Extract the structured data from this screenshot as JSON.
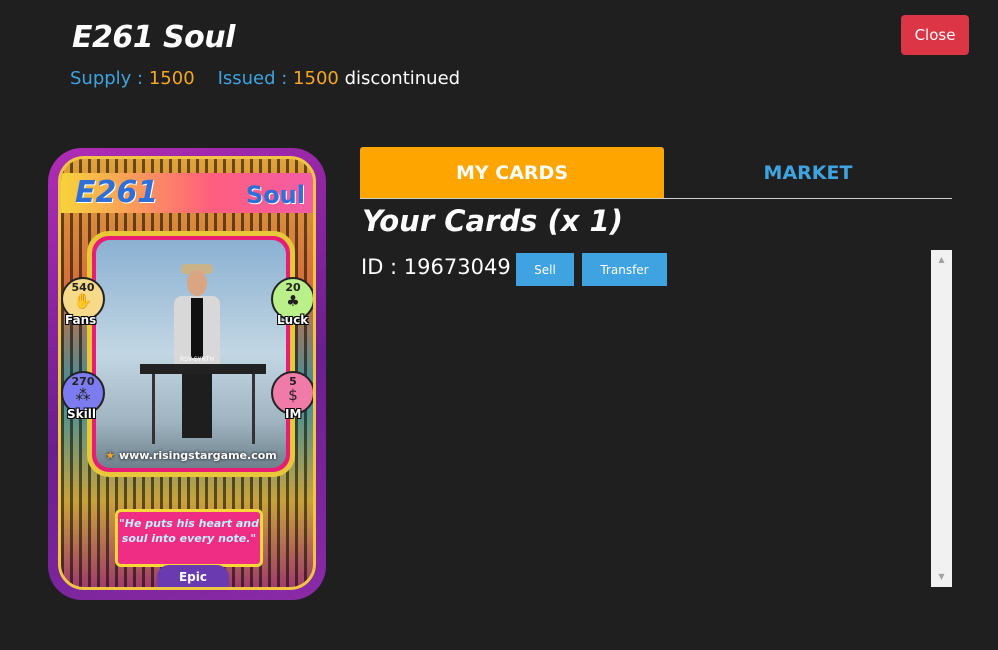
{
  "header": {
    "title": "E261 Soul",
    "supply_label": "Supply : ",
    "supply_value": "1500",
    "issued_label": "Issued : ",
    "issued_value": "1500",
    "status": "discontinued",
    "close_label": "Close"
  },
  "card": {
    "code": "E261",
    "name": "Soul",
    "stats": {
      "fans": {
        "value": "540",
        "label": "Fans",
        "icon": "crowd-icon",
        "color": "#f7d98a"
      },
      "luck": {
        "value": "20",
        "label": "Luck",
        "icon": "clover-icon",
        "color": "#b9f08a"
      },
      "skill": {
        "value": "270",
        "label": "Skill",
        "icon": "skill-icon",
        "color": "#7c7cf0"
      },
      "im": {
        "value": "5",
        "label": "IM",
        "icon": "money-icon",
        "color": "#f07ba8"
      }
    },
    "synth_label": "RSV-SYNTH",
    "website": "www.risingstargame.com",
    "quote": "\"He puts his heart and soul into every note.\"",
    "rarity": "Epic"
  },
  "tabs": {
    "my_cards": "MY CARDS",
    "market": "MARKET",
    "active": "my_cards"
  },
  "cards_panel": {
    "heading": "Your Cards (x 1)",
    "id_text": "ID : 19673049",
    "sell_label": "Sell",
    "transfer_label": "Transfer"
  },
  "colors": {
    "background": "#1f1f1f",
    "accent_orange": "#ffa500",
    "accent_blue": "#3ea3e0",
    "close_red": "#dc3545"
  }
}
